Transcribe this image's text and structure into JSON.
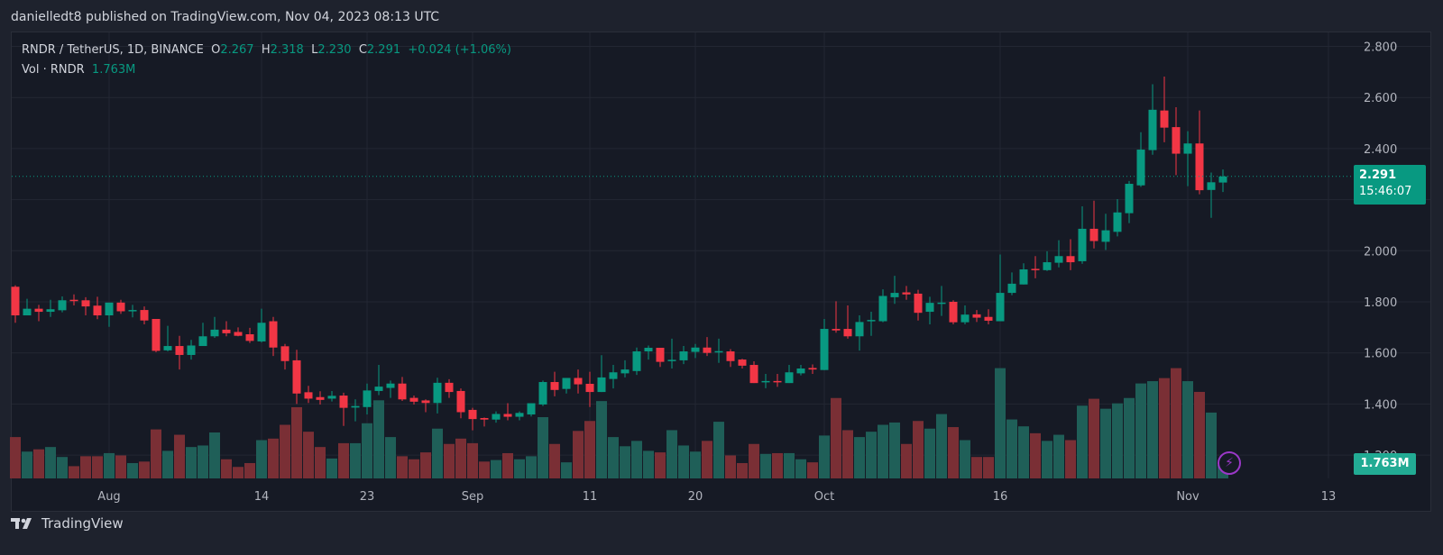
{
  "publish_line": "danielledt8 published on TradingView.com, Nov 04, 2023 08:13 UTC",
  "legend": {
    "symbol": "RNDR / TetherUS, 1D, BINANCE",
    "o_label": "O",
    "o": "2.267",
    "h_label": "H",
    "h": "2.318",
    "l_label": "L",
    "l": "2.230",
    "c_label": "C",
    "c": "2.291",
    "change": "+0.024 (+1.06%)",
    "vol_label": "Vol · RNDR",
    "vol": "1.763M"
  },
  "price_tag": {
    "price": "2.291",
    "countdown": "15:46:07"
  },
  "volume_tag": "1.763M",
  "footer": {
    "brand": "TradingView",
    "logo_icon": "tradingview-logo-icon"
  },
  "colors": {
    "up": "#089981",
    "down": "#f23645",
    "vol_up": "#1f5f58",
    "vol_down": "#7a2f35",
    "grid": "#232733",
    "bg": "#161a25"
  },
  "chart_data": {
    "type": "candlestick",
    "title": "RNDR / TetherUS, 1D, BINANCE",
    "ylim": [
      1.2,
      2.8
    ],
    "price_ticks": [
      "2.800",
      "2.600",
      "2.400",
      "2.200",
      "2.000",
      "1.800",
      "1.600",
      "1.400",
      "1.200"
    ],
    "price_tick_values": [
      2.8,
      2.6,
      2.4,
      2.2,
      2.0,
      1.8,
      1.6,
      1.4,
      1.2
    ],
    "time_ticks": [
      {
        "label": "Aug",
        "date": "2023-08-01"
      },
      {
        "label": "14",
        "date": "2023-08-14"
      },
      {
        "label": "23",
        "date": "2023-08-23"
      },
      {
        "label": "Sep",
        "date": "2023-09-01"
      },
      {
        "label": "11",
        "date": "2023-09-11"
      },
      {
        "label": "20",
        "date": "2023-09-20"
      },
      {
        "label": "Oct",
        "date": "2023-10-01"
      },
      {
        "label": "16",
        "date": "2023-10-16"
      },
      {
        "label": "Nov",
        "date": "2023-11-01"
      },
      {
        "label": "13",
        "date": "2023-11-13"
      }
    ],
    "grid": true,
    "last_price": 2.291,
    "dates": [
      "2023-07-24",
      "2023-07-25",
      "2023-07-26",
      "2023-07-27",
      "2023-07-28",
      "2023-07-29",
      "2023-07-30",
      "2023-07-31",
      "2023-08-01",
      "2023-08-02",
      "2023-08-03",
      "2023-08-04",
      "2023-08-05",
      "2023-08-06",
      "2023-08-07",
      "2023-08-08",
      "2023-08-09",
      "2023-08-10",
      "2023-08-11",
      "2023-08-12",
      "2023-08-13",
      "2023-08-14",
      "2023-08-15",
      "2023-08-16",
      "2023-08-17",
      "2023-08-18",
      "2023-08-19",
      "2023-08-20",
      "2023-08-21",
      "2023-08-22",
      "2023-08-23",
      "2023-08-24",
      "2023-08-25",
      "2023-08-26",
      "2023-08-27",
      "2023-08-28",
      "2023-08-29",
      "2023-08-30",
      "2023-08-31",
      "2023-09-01",
      "2023-09-02",
      "2023-09-03",
      "2023-09-04",
      "2023-09-05",
      "2023-09-06",
      "2023-09-07",
      "2023-09-08",
      "2023-09-09",
      "2023-09-10",
      "2023-09-11",
      "2023-09-12",
      "2023-09-13",
      "2023-09-14",
      "2023-09-15",
      "2023-09-16",
      "2023-09-17",
      "2023-09-18",
      "2023-09-19",
      "2023-09-20",
      "2023-09-21",
      "2023-09-22",
      "2023-09-23",
      "2023-09-24",
      "2023-09-25",
      "2023-09-26",
      "2023-09-27",
      "2023-09-28",
      "2023-09-29",
      "2023-09-30",
      "2023-10-01",
      "2023-10-02",
      "2023-10-03",
      "2023-10-04",
      "2023-10-05",
      "2023-10-06",
      "2023-10-07",
      "2023-10-08",
      "2023-10-09",
      "2023-10-10",
      "2023-10-11",
      "2023-10-12",
      "2023-10-13",
      "2023-10-14",
      "2023-10-15",
      "2023-10-16",
      "2023-10-17",
      "2023-10-18",
      "2023-10-19",
      "2023-10-20",
      "2023-10-21",
      "2023-10-22",
      "2023-10-23",
      "2023-10-24",
      "2023-10-25",
      "2023-10-26",
      "2023-10-27",
      "2023-10-28",
      "2023-10-29",
      "2023-10-30",
      "2023-10-31",
      "2023-11-01",
      "2023-11-02",
      "2023-11-03",
      "2023-11-04"
    ],
    "ohlc": [
      [
        1.859,
        1.865,
        1.718,
        1.747
      ],
      [
        1.747,
        1.812,
        1.747,
        1.773
      ],
      [
        1.773,
        1.788,
        1.724,
        1.761
      ],
      [
        1.761,
        1.808,
        1.741,
        1.771
      ],
      [
        1.767,
        1.821,
        1.759,
        1.806
      ],
      [
        1.808,
        1.829,
        1.786,
        1.803
      ],
      [
        1.806,
        1.818,
        1.747,
        1.782
      ],
      [
        1.785,
        1.82,
        1.732,
        1.747
      ],
      [
        1.747,
        1.797,
        1.702,
        1.797
      ],
      [
        1.797,
        1.808,
        1.753,
        1.763
      ],
      [
        1.765,
        1.788,
        1.739,
        1.768
      ],
      [
        1.768,
        1.782,
        1.712,
        1.727
      ],
      [
        1.733,
        1.733,
        1.603,
        1.608
      ],
      [
        1.61,
        1.706,
        1.606,
        1.627
      ],
      [
        1.627,
        1.667,
        1.535,
        1.592
      ],
      [
        1.592,
        1.651,
        1.574,
        1.629
      ],
      [
        1.627,
        1.718,
        1.627,
        1.665
      ],
      [
        1.665,
        1.741,
        1.659,
        1.691
      ],
      [
        1.691,
        1.724,
        1.665,
        1.677
      ],
      [
        1.682,
        1.7,
        1.665,
        1.667
      ],
      [
        1.673,
        1.698,
        1.639,
        1.647
      ],
      [
        1.645,
        1.773,
        1.641,
        1.718
      ],
      [
        1.724,
        1.741,
        1.588,
        1.621
      ],
      [
        1.626,
        1.635,
        1.535,
        1.568
      ],
      [
        1.571,
        1.612,
        1.4,
        1.441
      ],
      [
        1.446,
        1.471,
        1.404,
        1.421
      ],
      [
        1.427,
        1.45,
        1.398,
        1.416
      ],
      [
        1.421,
        1.451,
        1.41,
        1.432
      ],
      [
        1.433,
        1.444,
        1.314,
        1.385
      ],
      [
        1.386,
        1.418,
        1.332,
        1.392
      ],
      [
        1.388,
        1.48,
        1.359,
        1.453
      ],
      [
        1.451,
        1.553,
        1.435,
        1.468
      ],
      [
        1.463,
        1.492,
        1.424,
        1.48
      ],
      [
        1.48,
        1.506,
        1.412,
        1.418
      ],
      [
        1.424,
        1.433,
        1.398,
        1.409
      ],
      [
        1.414,
        1.418,
        1.368,
        1.404
      ],
      [
        1.404,
        1.503,
        1.363,
        1.483
      ],
      [
        1.483,
        1.497,
        1.424,
        1.447
      ],
      [
        1.451,
        1.461,
        1.344,
        1.368
      ],
      [
        1.377,
        1.385,
        1.297,
        1.341
      ],
      [
        1.345,
        1.347,
        1.312,
        1.339
      ],
      [
        1.339,
        1.371,
        1.327,
        1.361
      ],
      [
        1.361,
        1.403,
        1.336,
        1.35
      ],
      [
        1.35,
        1.371,
        1.336,
        1.365
      ],
      [
        1.359,
        1.403,
        1.351,
        1.403
      ],
      [
        1.398,
        1.492,
        1.392,
        1.486
      ],
      [
        1.486,
        1.526,
        1.43,
        1.455
      ],
      [
        1.459,
        1.502,
        1.441,
        1.502
      ],
      [
        1.502,
        1.535,
        1.441,
        1.477
      ],
      [
        1.479,
        1.526,
        1.388,
        1.447
      ],
      [
        1.447,
        1.591,
        1.447,
        1.504
      ],
      [
        1.498,
        1.553,
        1.461,
        1.524
      ],
      [
        1.52,
        1.571,
        1.504,
        1.535
      ],
      [
        1.529,
        1.621,
        1.514,
        1.606
      ],
      [
        1.606,
        1.629,
        1.574,
        1.62
      ],
      [
        1.62,
        1.62,
        1.545,
        1.565
      ],
      [
        1.568,
        1.656,
        1.539,
        1.573
      ],
      [
        1.571,
        1.627,
        1.556,
        1.606
      ],
      [
        1.604,
        1.635,
        1.58,
        1.621
      ],
      [
        1.621,
        1.662,
        1.588,
        1.6
      ],
      [
        1.602,
        1.656,
        1.561,
        1.607
      ],
      [
        1.606,
        1.615,
        1.545,
        1.568
      ],
      [
        1.574,
        1.577,
        1.539,
        1.55
      ],
      [
        1.553,
        1.567,
        1.482,
        1.482
      ],
      [
        1.485,
        1.518,
        1.462,
        1.49
      ],
      [
        1.49,
        1.518,
        1.467,
        1.485
      ],
      [
        1.482,
        1.553,
        1.482,
        1.524
      ],
      [
        1.52,
        1.553,
        1.512,
        1.539
      ],
      [
        1.541,
        1.555,
        1.518,
        1.535
      ],
      [
        1.533,
        1.733,
        1.533,
        1.694
      ],
      [
        1.694,
        1.802,
        1.679,
        1.688
      ],
      [
        1.694,
        1.786,
        1.656,
        1.665
      ],
      [
        1.665,
        1.747,
        1.609,
        1.721
      ],
      [
        1.724,
        1.761,
        1.667,
        1.729
      ],
      [
        1.724,
        1.849,
        1.72,
        1.823
      ],
      [
        1.818,
        1.902,
        1.792,
        1.835
      ],
      [
        1.837,
        1.862,
        1.808,
        1.829
      ],
      [
        1.832,
        1.847,
        1.727,
        1.757
      ],
      [
        1.761,
        1.82,
        1.712,
        1.796
      ],
      [
        1.792,
        1.862,
        1.745,
        1.797
      ],
      [
        1.8,
        1.806,
        1.712,
        1.72
      ],
      [
        1.72,
        1.786,
        1.712,
        1.75
      ],
      [
        1.751,
        1.768,
        1.721,
        1.738
      ],
      [
        1.741,
        1.771,
        1.712,
        1.726
      ],
      [
        1.724,
        1.985,
        1.724,
        1.835
      ],
      [
        1.835,
        1.915,
        1.826,
        1.871
      ],
      [
        1.868,
        1.951,
        1.868,
        1.927
      ],
      [
        1.929,
        1.979,
        1.892,
        1.924
      ],
      [
        1.924,
        1.998,
        1.921,
        1.955
      ],
      [
        1.953,
        2.041,
        1.935,
        1.979
      ],
      [
        1.979,
        2.045,
        1.924,
        1.955
      ],
      [
        1.959,
        2.174,
        1.949,
        2.086
      ],
      [
        2.086,
        2.196,
        2.009,
        2.038
      ],
      [
        2.035,
        2.145,
        2.003,
        2.08
      ],
      [
        2.074,
        2.202,
        2.056,
        2.15
      ],
      [
        2.147,
        2.273,
        2.108,
        2.262
      ],
      [
        2.256,
        2.464,
        2.25,
        2.396
      ],
      [
        2.394,
        2.652,
        2.376,
        2.552
      ],
      [
        2.549,
        2.682,
        2.425,
        2.482
      ],
      [
        2.484,
        2.562,
        2.296,
        2.38
      ],
      [
        2.38,
        2.468,
        2.253,
        2.42
      ],
      [
        2.42,
        2.549,
        2.221,
        2.237
      ],
      [
        2.238,
        2.306,
        2.129,
        2.268
      ],
      [
        2.267,
        2.318,
        2.23,
        2.291
      ]
    ],
    "volume_m": [
      5.4,
      3.5,
      3.8,
      4.1,
      2.8,
      1.6,
      2.9,
      2.9,
      3.3,
      3.0,
      2.0,
      2.2,
      6.4,
      3.6,
      5.7,
      4.1,
      4.3,
      6.0,
      2.5,
      1.5,
      2.0,
      5.0,
      5.2,
      7.0,
      9.3,
      6.1,
      4.1,
      2.6,
      4.6,
      4.6,
      7.2,
      10.2,
      5.4,
      2.9,
      2.5,
      3.4,
      6.5,
      4.5,
      5.2,
      4.6,
      2.2,
      2.4,
      3.3,
      2.5,
      2.9,
      8.0,
      4.5,
      2.1,
      6.2,
      7.5,
      10.1,
      5.4,
      4.2,
      4.9,
      3.6,
      3.4,
      6.3,
      4.3,
      3.5,
      4.9,
      7.4,
      3.0,
      2.0,
      4.5,
      3.2,
      3.3,
      3.3,
      2.5,
      2.1,
      5.6,
      10.5,
      6.3,
      5.4,
      6.1,
      7.0,
      7.3,
      4.5,
      7.5,
      6.5,
      8.4,
      6.7,
      5.0,
      2.8,
      2.8,
      14.4,
      7.7,
      6.8,
      5.9,
      4.9,
      5.7,
      5.0,
      9.5,
      10.4,
      9.1,
      9.8,
      10.5,
      12.4,
      12.7,
      13.1,
      14.4,
      12.7,
      11.3,
      8.6,
      1.763
    ]
  }
}
